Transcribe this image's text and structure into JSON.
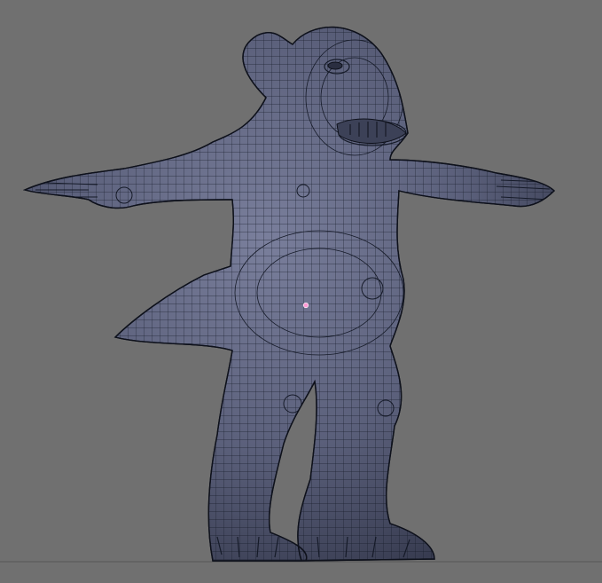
{
  "viewport": {
    "background": "#707070",
    "mesh_color": "#5a5f7a",
    "wire_color": "#151a28",
    "selected_vertex_color": "#ff9ad5"
  },
  "model": {
    "pose": "T-pose",
    "display": "wireframe-over-solid"
  }
}
